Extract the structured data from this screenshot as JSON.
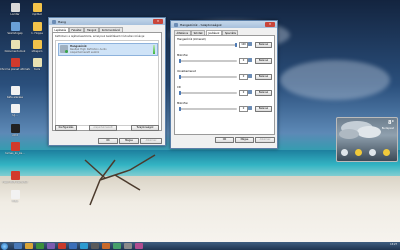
{
  "desktop": {
    "icons": [
      {
        "label": "Lomtár",
        "color": "#d9d9d9"
      },
      {
        "label": "mp3bol",
        "color": "#f3c34a"
      },
      {
        "label": "Számítógép",
        "color": "#6aa0d8"
      },
      {
        "label": "1. Hoppa",
        "color": "#f3c34a"
      },
      {
        "label": "Dokumentumok",
        "color": "#e9e2b3"
      },
      {
        "label": "útbejáró",
        "color": "#f3c34a"
      },
      {
        "label": "Chrome planet ultimate",
        "color": "#d23a2c"
      },
      {
        "label": "tools",
        "color": "#e9e2b3"
      },
      {
        "label": "Kéfe elérése",
        "color": "#f2f2f2"
      },
      {
        "label": "Új...",
        "color": "#f2f2f2"
      },
      {
        "label": "cmd",
        "color": "#222222"
      },
      {
        "label": "tamas_ko_ka...",
        "color": "#d23a2c"
      },
      {
        "label": "Flash MP3 Recorder",
        "color": "#d23a2c"
      },
      {
        "label": "Hiba",
        "color": "#f2f2f2"
      }
    ]
  },
  "sound_dialog": {
    "title": "Hang",
    "tabs": [
      "Lejátszás",
      "Felvétel",
      "Hangok",
      "Kommunikáció"
    ],
    "instruction": "Kattintson a lejátszóeszközre, amelynek beállításait módosítani kívánja:",
    "device_name": "Hangszórók",
    "device_desc": "Realtek High Definition Audio",
    "device_status": "Alapértelmezett eszköz",
    "configure_label": "Konfigurálás",
    "set_default_label": "Alapértelmezett",
    "properties_label": "Tulajdonságok",
    "ok_label": "OK",
    "cancel_label": "Mégse",
    "apply_label": "Alkalmaz"
  },
  "props_dialog": {
    "title": "Hangszórók - tulajdonságok",
    "tabs": [
      "Általános",
      "Szintek",
      "Javítások",
      "Speciális"
    ],
    "sections": [
      {
        "label": "Hangszórók (kimenet)",
        "value": "100",
        "balance_label": "Balansz"
      },
      {
        "label": "Mikrofon",
        "value": "0",
        "balance_label": "Balansz"
      },
      {
        "label": "Vonalbemenet",
        "value": "0",
        "balance_label": "Balansz"
      },
      {
        "label": "CD",
        "value": "0",
        "balance_label": "Balansz"
      },
      {
        "label": "Mikrofon",
        "value": "0",
        "balance_label": "Balansz"
      }
    ],
    "ok_label": "OK",
    "cancel_label": "Mégse",
    "apply_label": "Alkalmaz"
  },
  "weather_gadget": {
    "temperature": "8°",
    "location": "Budapest",
    "forecast_icons": [
      "cloud-icon",
      "sun-icon",
      "cloud-icon",
      "sun-icon"
    ]
  },
  "taskbar": {
    "items_colors": [
      "#4a7ab8",
      "#d9a436",
      "#3b8f3b",
      "#7b5bb0",
      "#c83a2b",
      "#3b6fb8",
      "#2b9bd1",
      "#5a5a5a",
      "#c86a2b",
      "#46a06a",
      "#8a8a8a",
      "#b04c8f"
    ],
    "time": "13:27",
    "date": "2009.11.23."
  }
}
